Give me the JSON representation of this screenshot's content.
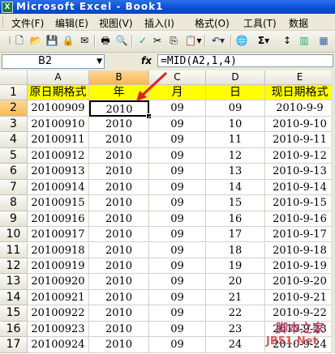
{
  "window": {
    "title": "Microsoft Excel - Book1"
  },
  "menu": [
    "文件(F)",
    "编辑(E)",
    "视图(V)",
    "插入(I)",
    "格式(O)",
    "工具(T)",
    "数据"
  ],
  "toolbar": {
    "icons": [
      "new-icon",
      "open-icon",
      "save-icon",
      "permission-icon",
      "email-icon",
      "print-icon",
      "print-preview-icon",
      "spelling-icon",
      "cut-icon",
      "copy-icon",
      "paste-icon",
      "format-painter-icon",
      "undo-icon",
      "redo-icon",
      "hyperlink-icon",
      "autosum-icon",
      "sort-icon"
    ],
    "sigma": "Σ"
  },
  "formula_bar": {
    "name_box": "B2",
    "fx": "fx",
    "formula": "=MID(A2,1,4)"
  },
  "grid": {
    "columns": [
      "A",
      "B",
      "C",
      "D",
      "E"
    ],
    "rows": [
      "1",
      "2",
      "3",
      "4",
      "5",
      "6",
      "7",
      "8",
      "9",
      "10",
      "11",
      "12",
      "13",
      "14",
      "15",
      "16",
      "17"
    ],
    "header_row": [
      "原日期格式",
      "年",
      "月",
      "日",
      "现日期格式"
    ],
    "data": [
      [
        "20100909",
        "2010",
        "09",
        "09",
        "2010-9-9"
      ],
      [
        "20100910",
        "2010",
        "09",
        "10",
        "2010-9-10"
      ],
      [
        "20100911",
        "2010",
        "09",
        "11",
        "2010-9-11"
      ],
      [
        "20100912",
        "2010",
        "09",
        "12",
        "2010-9-12"
      ],
      [
        "20100913",
        "2010",
        "09",
        "13",
        "2010-9-13"
      ],
      [
        "20100914",
        "2010",
        "09",
        "14",
        "2010-9-14"
      ],
      [
        "20100915",
        "2010",
        "09",
        "15",
        "2010-9-15"
      ],
      [
        "20100916",
        "2010",
        "09",
        "16",
        "2010-9-16"
      ],
      [
        "20100917",
        "2010",
        "09",
        "17",
        "2010-9-17"
      ],
      [
        "20100918",
        "2010",
        "09",
        "18",
        "2010-9-18"
      ],
      [
        "20100919",
        "2010",
        "09",
        "19",
        "2010-9-19"
      ],
      [
        "20100920",
        "2010",
        "09",
        "20",
        "2010-9-20"
      ],
      [
        "20100921",
        "2010",
        "09",
        "21",
        "2010-9-21"
      ],
      [
        "20100922",
        "2010",
        "09",
        "22",
        "2010-9-22"
      ],
      [
        "20100923",
        "2010",
        "09",
        "23",
        "2010-9-23"
      ],
      [
        "20100924",
        "2010",
        "09",
        "24",
        "2010-9-24"
      ]
    ],
    "active_cell": "B2"
  },
  "watermark": {
    "line1": "脚本之家",
    "line2": "JB51.Net"
  },
  "colors": {
    "header_fill": "#ffff00",
    "arrow": "#e02020",
    "selected_header": "#f8b84d"
  }
}
